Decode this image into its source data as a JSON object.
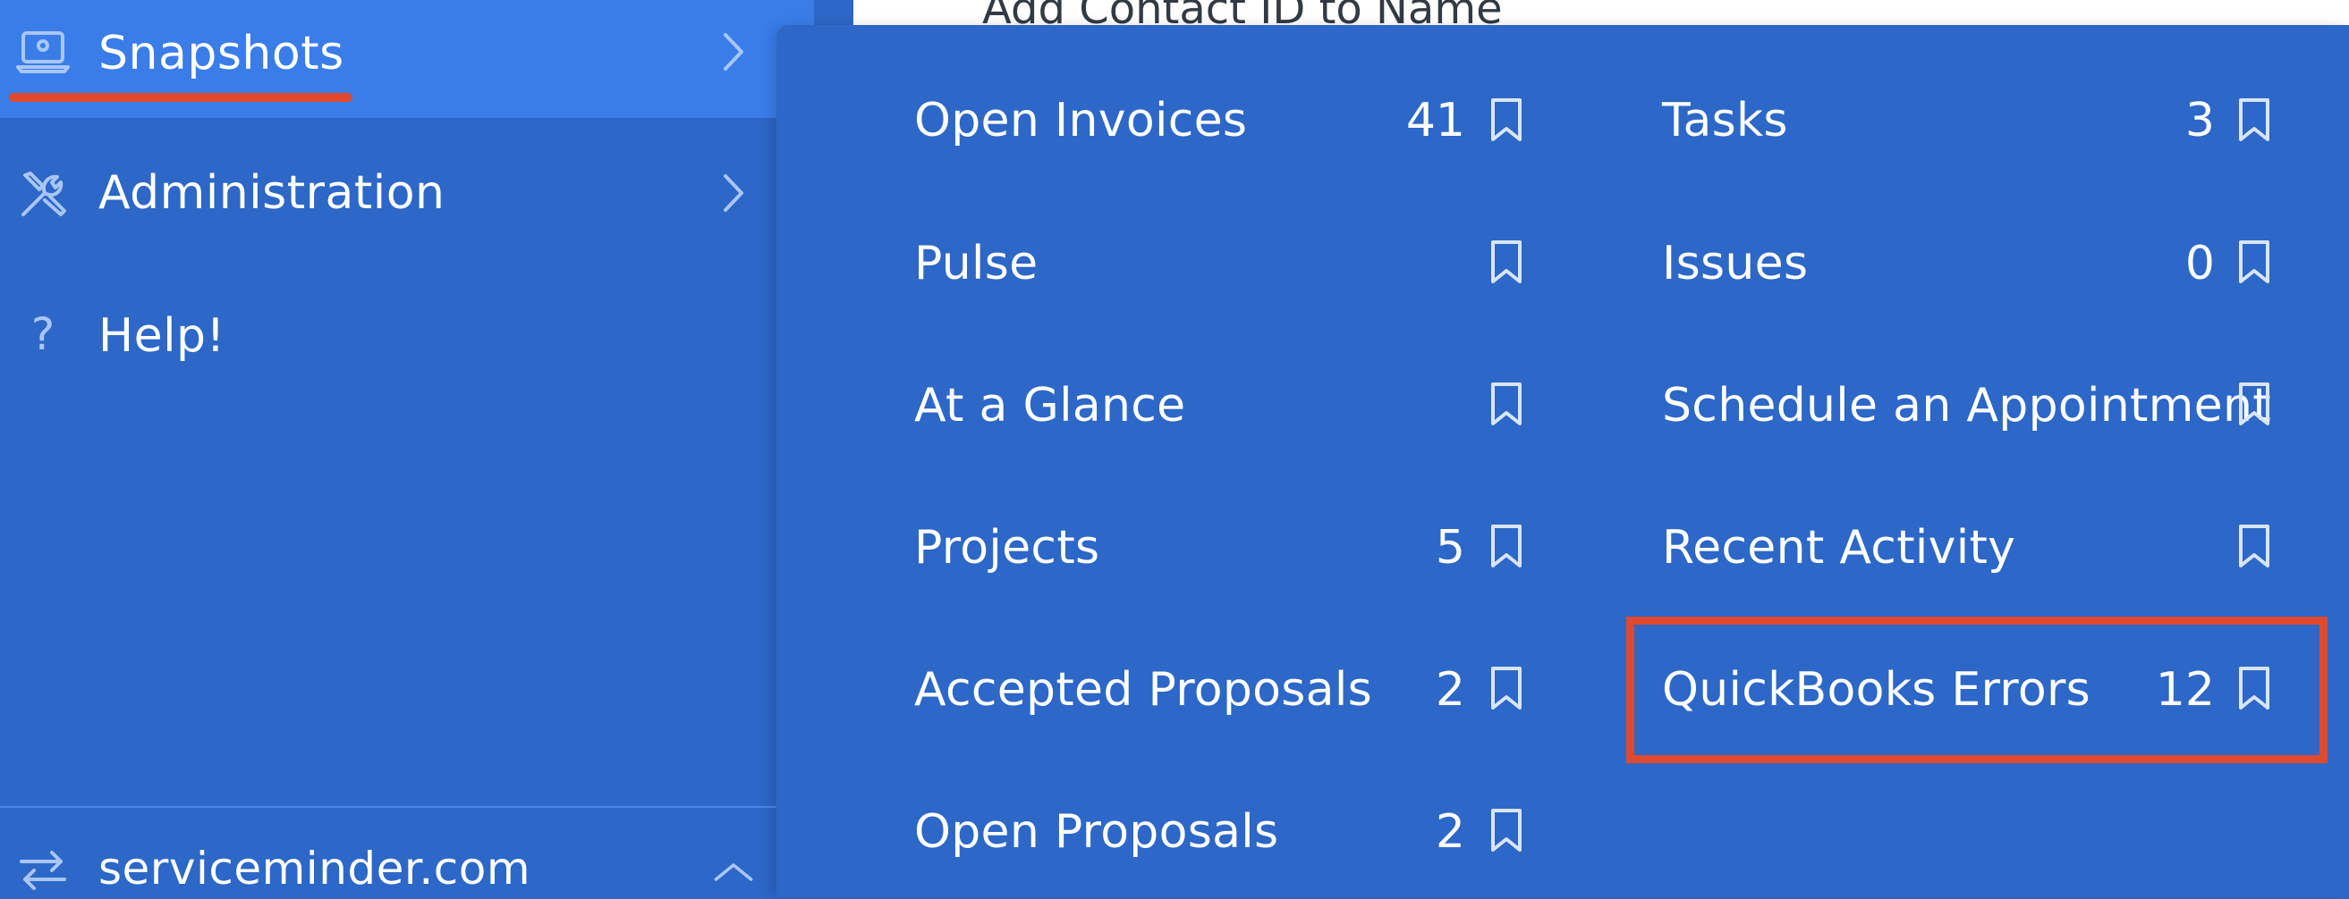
{
  "page": {
    "underlying_text": "Add Contact ID to Name"
  },
  "sidebar": {
    "items": [
      {
        "label": "Snapshots",
        "icon": "laptop-icon",
        "active": true
      },
      {
        "label": "Administration",
        "icon": "tools-icon",
        "active": false
      },
      {
        "label": "Help!",
        "icon": "question-icon",
        "active": false
      }
    ],
    "footer": {
      "label": "serviceminder.com",
      "icon": "swap-arrows-icon"
    }
  },
  "snapshots": {
    "left_column": [
      {
        "label": "Open Invoices",
        "count": "41"
      },
      {
        "label": "Pulse",
        "count": ""
      },
      {
        "label": "At a Glance",
        "count": ""
      },
      {
        "label": "Projects",
        "count": "5"
      },
      {
        "label": "Accepted Proposals",
        "count": "2"
      },
      {
        "label": "Open Proposals",
        "count": "2"
      }
    ],
    "right_column": [
      {
        "label": "Tasks",
        "count": "3"
      },
      {
        "label": "Issues",
        "count": "0"
      },
      {
        "label": "Schedule an Appointment",
        "count": ""
      },
      {
        "label": "Recent Activity",
        "count": ""
      },
      {
        "label": "QuickBooks Errors",
        "count": "12"
      }
    ]
  },
  "colors": {
    "panel": "#2d67c7",
    "active": "#3a7de9",
    "annotation": "#e0492c",
    "icon": "#a9c6f7"
  }
}
